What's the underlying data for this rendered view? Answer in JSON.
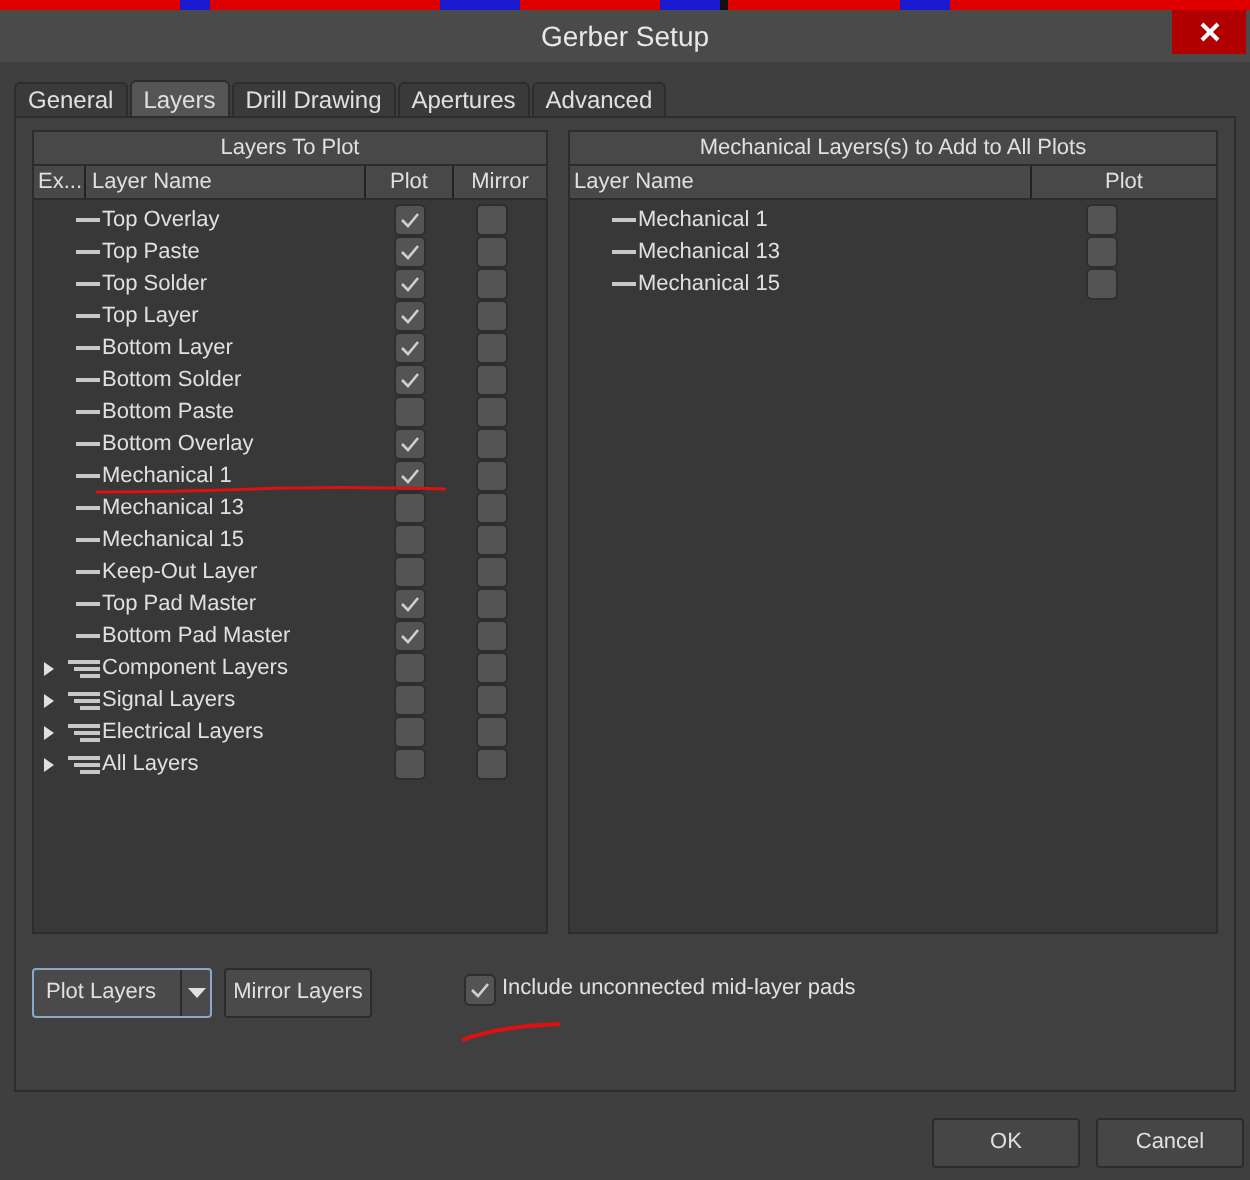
{
  "window": {
    "title": "Gerber Setup"
  },
  "tabs": [
    {
      "label": "General",
      "selected": false
    },
    {
      "label": "Layers",
      "selected": true
    },
    {
      "label": "Drill Drawing",
      "selected": false
    },
    {
      "label": "Apertures",
      "selected": false
    },
    {
      "label": "Advanced",
      "selected": false
    }
  ],
  "layers_to_plot": {
    "title": "Layers To Plot",
    "columns": [
      "Ex...",
      "Layer Name",
      "Plot",
      "Mirror"
    ],
    "rows": [
      {
        "kind": "layer",
        "name": "Top Overlay",
        "plot": true,
        "mirror": false
      },
      {
        "kind": "layer",
        "name": "Top Paste",
        "plot": true,
        "mirror": false
      },
      {
        "kind": "layer",
        "name": "Top Solder",
        "plot": true,
        "mirror": false
      },
      {
        "kind": "layer",
        "name": "Top Layer",
        "plot": true,
        "mirror": false
      },
      {
        "kind": "layer",
        "name": "Bottom Layer",
        "plot": true,
        "mirror": false
      },
      {
        "kind": "layer",
        "name": "Bottom Solder",
        "plot": true,
        "mirror": false
      },
      {
        "kind": "layer",
        "name": "Bottom Paste",
        "plot": false,
        "mirror": false
      },
      {
        "kind": "layer",
        "name": "Bottom Overlay",
        "plot": true,
        "mirror": false
      },
      {
        "kind": "layer",
        "name": "Mechanical 1",
        "plot": true,
        "mirror": false
      },
      {
        "kind": "layer",
        "name": "Mechanical 13",
        "plot": false,
        "mirror": false
      },
      {
        "kind": "layer",
        "name": "Mechanical 15",
        "plot": false,
        "mirror": false
      },
      {
        "kind": "layer",
        "name": "Keep-Out Layer",
        "plot": false,
        "mirror": false
      },
      {
        "kind": "layer",
        "name": "Top Pad Master",
        "plot": true,
        "mirror": false
      },
      {
        "kind": "layer",
        "name": "Bottom Pad Master",
        "plot": true,
        "mirror": false
      },
      {
        "kind": "group",
        "name": "Component Layers",
        "expanded": false,
        "plot": false,
        "mirror": false
      },
      {
        "kind": "group",
        "name": "Signal Layers",
        "expanded": false,
        "plot": false,
        "mirror": false
      },
      {
        "kind": "group",
        "name": "Electrical Layers",
        "expanded": false,
        "plot": false,
        "mirror": false
      },
      {
        "kind": "group",
        "name": "All Layers",
        "expanded": false,
        "plot": false,
        "mirror": false
      }
    ]
  },
  "mechanical_layers": {
    "title": "Mechanical Layers(s) to Add to All Plots",
    "columns": [
      "Layer Name",
      "Plot"
    ],
    "rows": [
      {
        "name": "Mechanical 1",
        "plot": false
      },
      {
        "name": "Mechanical 13",
        "plot": false
      },
      {
        "name": "Mechanical 15",
        "plot": false
      }
    ]
  },
  "plot_layers_button": "Plot Layers",
  "mirror_layers_button": "Mirror Layers",
  "include_pads": {
    "label": "Include unconnected mid-layer pads",
    "checked": true
  },
  "buttons": [
    "OK",
    "Cancel"
  ]
}
